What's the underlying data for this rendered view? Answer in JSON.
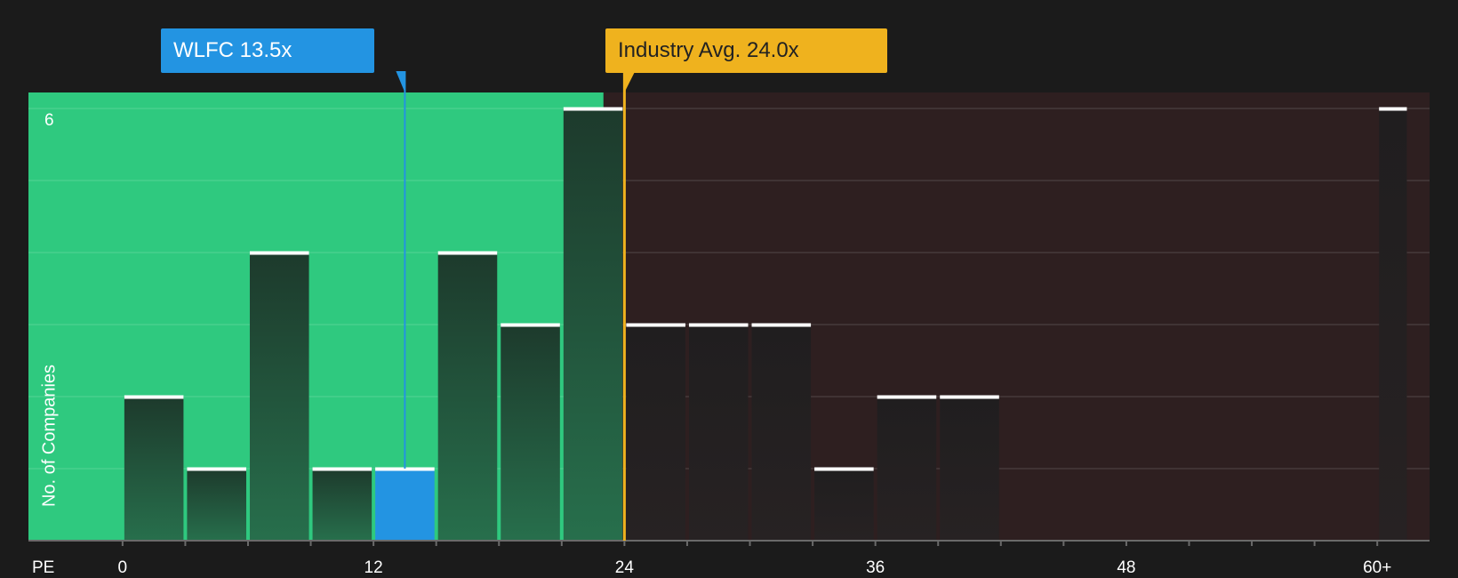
{
  "chart_data": {
    "type": "bar",
    "x_axis_label": "PE",
    "y_axis_label": "No. of Companies",
    "y_top_tick": "6",
    "ylim": [
      0,
      6
    ],
    "xlim": [
      -4.5,
      62.5
    ],
    "x_tick_labels": [
      {
        "value": 0,
        "label": "0"
      },
      {
        "value": 12,
        "label": "12"
      },
      {
        "value": 24,
        "label": "24"
      },
      {
        "value": 36,
        "label": "36"
      },
      {
        "value": 48,
        "label": "48"
      },
      {
        "value": 60,
        "label": "60+"
      }
    ],
    "bin_width": 3,
    "bins": [
      {
        "start": 0,
        "end": 3,
        "count": 2
      },
      {
        "start": 3,
        "end": 6,
        "count": 1
      },
      {
        "start": 6,
        "end": 9,
        "count": 4
      },
      {
        "start": 9,
        "end": 12,
        "count": 1
      },
      {
        "start": 12,
        "end": 15,
        "count": 1,
        "highlight": true
      },
      {
        "start": 15,
        "end": 18,
        "count": 4
      },
      {
        "start": 18,
        "end": 21,
        "count": 3
      },
      {
        "start": 21,
        "end": 24,
        "count": 6
      },
      {
        "start": 24,
        "end": 27,
        "count": 3
      },
      {
        "start": 27,
        "end": 30,
        "count": 3
      },
      {
        "start": 30,
        "end": 33,
        "count": 3
      },
      {
        "start": 33,
        "end": 36,
        "count": 1
      },
      {
        "start": 36,
        "end": 39,
        "count": 2
      },
      {
        "start": 39,
        "end": 42,
        "count": 2
      },
      {
        "start": 60,
        "end": 61.5,
        "count": 6
      }
    ],
    "company": {
      "name": "WLFC",
      "value": 13.5,
      "label": "WLFC 13.5x"
    },
    "industry_avg": {
      "value": 24.0,
      "label": "Industry Avg. 24.0x"
    },
    "undervalued_region_end": 23,
    "colors": {
      "page_bg": "#1b1b1b",
      "undervalued_region": "#2fc97f",
      "overvalued_region": "#2e1f20",
      "company": "#2394e2",
      "industry": "#efb21e",
      "bar_dark": "#1f3b2e",
      "bar_gray": "#242021"
    }
  }
}
